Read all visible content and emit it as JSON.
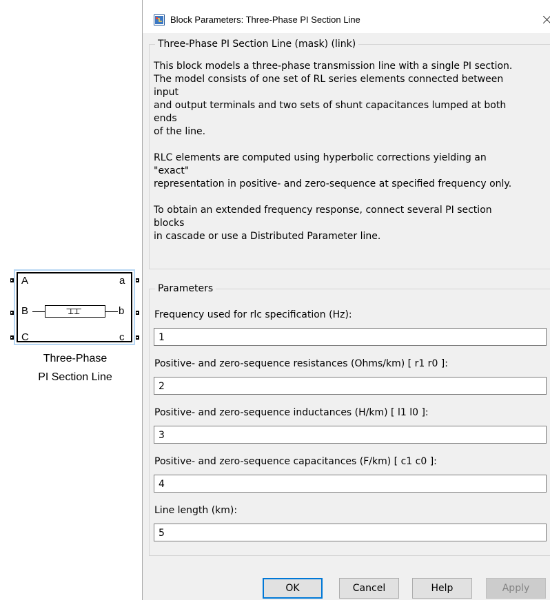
{
  "block": {
    "name_line1": "Three-Phase",
    "name_line2": "PI Section Line",
    "ports": {
      "left": [
        "A",
        "B",
        "C"
      ],
      "right": [
        "a",
        "b",
        "c"
      ]
    },
    "icon": "pi-section-symbol"
  },
  "dialog": {
    "title": "Block Parameters: Three-Phase PI Section Line",
    "title_icon": "simulink-block-icon",
    "close_icon": "close-icon",
    "mask_group_title": "Three-Phase PI Section Line (mask) (link)",
    "description": [
      "This block models a three-phase transmission line with a single PI section.",
      "The model consists of one set of RL series elements connected between",
      "input",
      "and output terminals and two sets of shunt capacitances lumped at both",
      "ends",
      "of the line.",
      "",
      "RLC elements are computed using hyperbolic corrections yielding an",
      "\"exact\"",
      "representation in positive- and zero-sequence at specified frequency only.",
      "",
      "To obtain an extended frequency response, connect several PI section",
      "blocks",
      "in cascade or use a Distributed Parameter line."
    ],
    "parameters_group_title": "Parameters",
    "parameters": [
      {
        "label": "Frequency used for rlc specification (Hz):",
        "value": "1"
      },
      {
        "label": "Positive- and zero-sequence resistances (Ohms/km) [ r1  r0 ]:",
        "value": "2"
      },
      {
        "label": "Positive- and zero-sequence inductances (H/km) [ l1  l0 ]:",
        "value": "3"
      },
      {
        "label": "Positive- and zero-sequence capacitances (F/km) [ c1 c0 ]:",
        "value": "4"
      },
      {
        "label": "Line length (km):",
        "value": "5"
      }
    ],
    "buttons": {
      "ok": "OK",
      "cancel": "Cancel",
      "help": "Help",
      "apply": "Apply"
    }
  },
  "colors": {
    "dialog_bg": "#f0f0f0",
    "selection_frame": "#b6d6f3",
    "default_button_border": "#0078d7",
    "disabled_text": "#838383"
  }
}
